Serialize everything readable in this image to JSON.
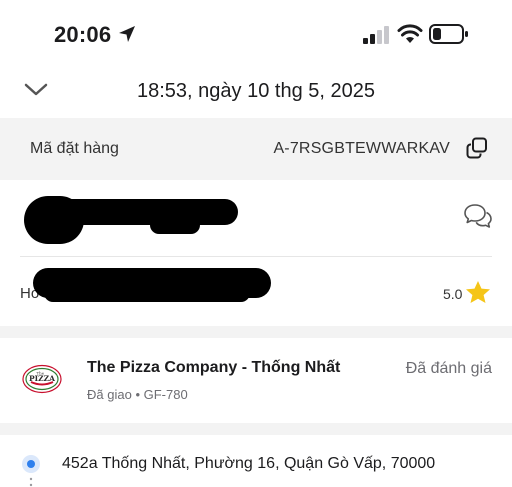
{
  "status_bar": {
    "time": "20:06",
    "icons": [
      "location-arrow-icon",
      "cellular-signal-icon",
      "wifi-icon",
      "battery-icon"
    ]
  },
  "header": {
    "title": "18:53, ngày 10 thg 5, 2025",
    "back_icon": "chevron-down-icon"
  },
  "order": {
    "label": "Mã đặt hàng",
    "code": "A-7RSGBTEWWARKAV",
    "copy_icon": "copy-icon"
  },
  "driver": {
    "vehicle_prefix": "Hơ",
    "rating": "5.0",
    "chat_icon": "chat-bubbles-icon",
    "rating_icon": "star-icon"
  },
  "restaurant": {
    "name": "The Pizza Company - Thống Nhất",
    "status": "Đã giao",
    "separator": "•",
    "code": "GF-780",
    "review_status": "Đã đánh giá",
    "logo_text": "The PIZZA"
  },
  "address": {
    "text": "452a Thống Nhất, Phường 16, Quận Gò Vấp, 70000"
  },
  "colors": {
    "background": "#ffffff",
    "section_gap": "#f3f3f3",
    "star": "#f5c518",
    "pin": "#2f80ed",
    "secondary_text": "#6d6d72"
  }
}
